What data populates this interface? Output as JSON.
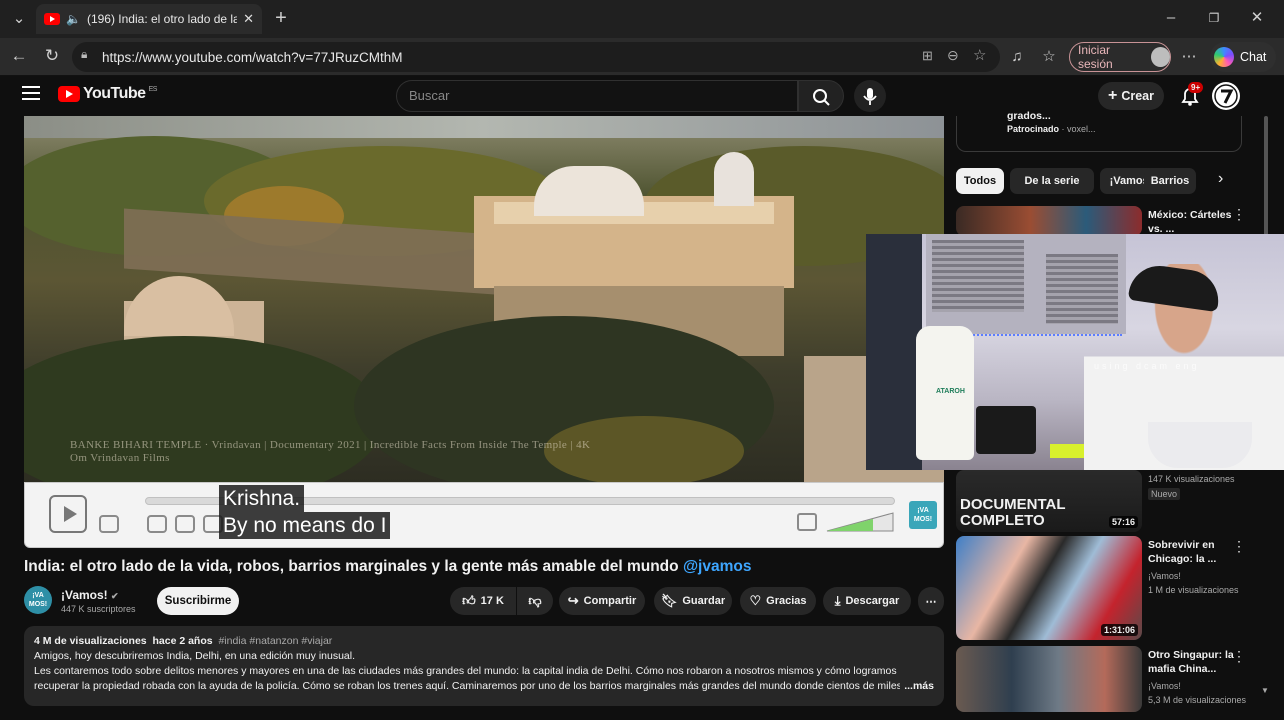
{
  "browser": {
    "tab_title": "(196) India: el otro lado de la vi",
    "url": "https://www.youtube.com/watch?v=77JRuzCMthM",
    "signin_label": "Iniciar sesión",
    "chat_label": "Chat"
  },
  "youtube": {
    "logo_text": "YouTube",
    "logo_country": "ES",
    "search_placeholder": "Buscar",
    "create_label": "Crear",
    "notif_count": "9+"
  },
  "video": {
    "overlay_text_1": "BANKE BIHARI TEMPLE · Vrindavan | Documentary 2021 | Incredible Facts From Inside The Temple | 4K",
    "overlay_text_2": "Om Vrindavan Films",
    "subtitle_line1": "Krishna.",
    "subtitle_line2": "By no means do I",
    "watermark": "¡VA MOS!"
  },
  "meta": {
    "title": "India: el otro lado de la vida, robos, barrios marginales y la gente más amable del mundo ",
    "handle": "@jvamos",
    "channel_name": "¡Vamos!",
    "channel_avatar_text": "¡VA MOS!",
    "subscribers": "447 K suscriptores",
    "subscribe_label": "Suscribirme",
    "likes": "17 K",
    "share_label": "Compartir",
    "save_label": "Guardar",
    "thanks_label": "Gracias",
    "download_label": "Descargar"
  },
  "description": {
    "views": "4 M de visualizaciones",
    "age": "hace 2 años",
    "tags": "#india #natanzon #viajar",
    "line1": "Amigos, hoy descubriremos India, Delhi, en una edición muy inusual.",
    "line2": "Les contaremos todo sobre delitos menores y mayores en una de las ciudades más grandes del mundo: la capital india de Delhi. Cómo nos robaron a nosotros mismos y cómo logramos",
    "line3": "recuperar la propiedad robada con la ayuda de la policía. Cómo se roban los trenes aquí. Caminaremos por uno de los barrios marginales más grandes del mundo donde cientos de miles d",
    "more": "...más"
  },
  "sidebar": {
    "sponsor_title": "grados...",
    "sponsor_label": "Patrocinado",
    "sponsor_source": "voxel...",
    "chips": [
      "Todos",
      "De la serie",
      "¡Vamos!",
      "Barrios"
    ],
    "recs": [
      {
        "title": "México: Cárteles vs. ...",
        "meta1": "",
        "meta2": "",
        "duration": ""
      },
      {
        "title": "",
        "meta1": "147 K visualizaciones",
        "meta2": "Nuevo",
        "duration": "57:16",
        "thumb_text1": "DOCUMENTAL",
        "thumb_text2": "COMPLETO"
      },
      {
        "title": "Sobrevivir en Chicago: la ...",
        "meta1": "¡Vamos!",
        "meta2": "1 M de visualizaciones",
        "duration": "1:31:06"
      },
      {
        "title": "Otro Singapur: la mafia China...",
        "meta1": "¡Vamos!",
        "meta2": "5,3 M de visualizaciones",
        "duration": ""
      }
    ]
  },
  "webcam": {
    "caption": "using dcam  eng"
  }
}
